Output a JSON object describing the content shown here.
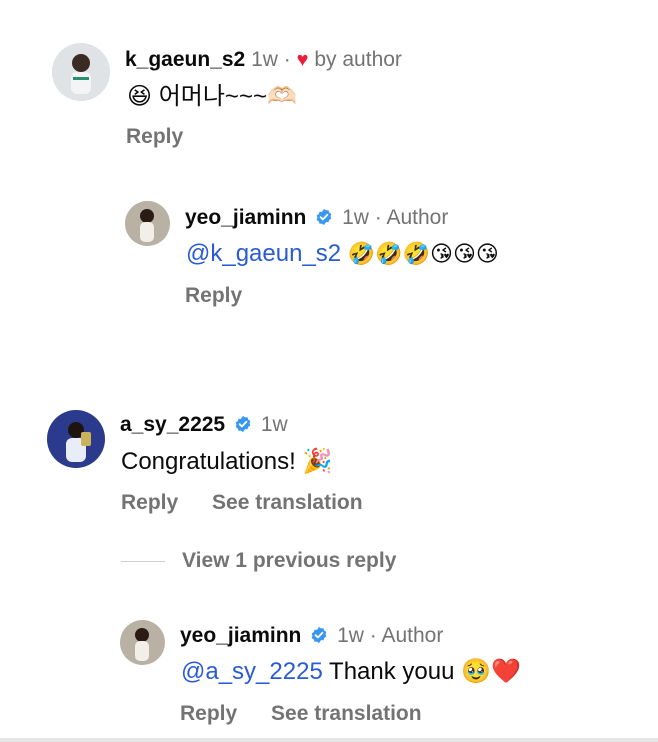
{
  "comments": [
    {
      "username": "k_gaeun_s2",
      "time": "1w",
      "sep": "·",
      "liked_by": "by author",
      "text": "😆 어머나~~~🫶🏻",
      "reply": "Reply"
    },
    {
      "username": "yeo_jiaminn",
      "time": "1w",
      "sep": "·",
      "role": "Author",
      "mention": "@k_gaeun_s2",
      "emojis": "🤣🤣🤣😘😘😘",
      "reply": "Reply"
    },
    {
      "username": "a_sy_2225",
      "time": "1w",
      "text": "Congratulations! 🎉",
      "reply": "Reply",
      "translate": "See translation"
    },
    {
      "username": "yeo_jiaminn",
      "time": "1w",
      "sep": "·",
      "role": "Author",
      "mention": "@a_sy_2225",
      "text": "Thank youu 🥹❤️",
      "reply": "Reply",
      "translate": "See translation"
    }
  ],
  "view_previous": "View 1 previous reply",
  "colors": {
    "mention": "#2a5bd7",
    "verified": "#3897f0",
    "heart": "#ee1d3b",
    "muted": "#737373"
  },
  "icons": {
    "like": "heart-icon",
    "badge": "verified-badge-icon"
  }
}
